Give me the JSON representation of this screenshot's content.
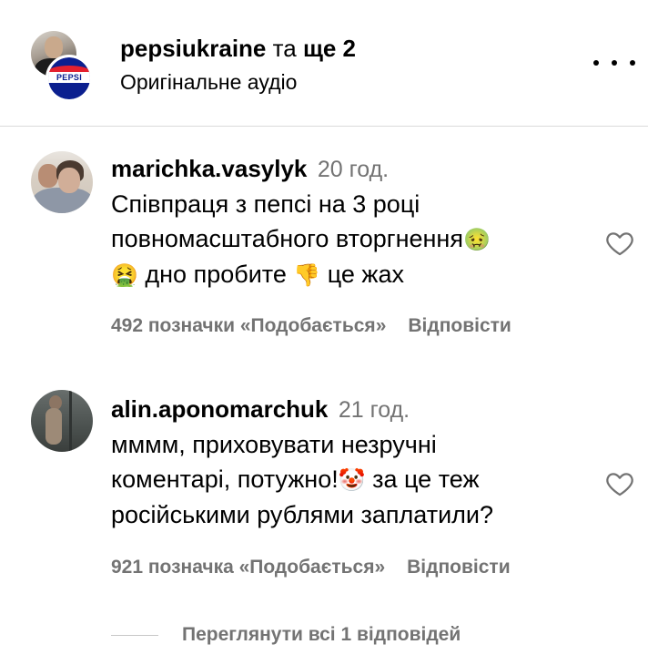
{
  "header": {
    "account": "pepsiukraine",
    "connector": " та ",
    "others": "ще 2",
    "subtitle": "Оригінальне аудіо",
    "more_icon": "more-horizontal-icon"
  },
  "comments": [
    {
      "username": "marichka.vasylyk",
      "time": "20 год.",
      "line1": "Співпраця з пепсі на 3 році",
      "line2a": "повномасштабного вторгнення",
      "emoji_nauseated": "🤢",
      "emoji_vomit": "🤮",
      "line3a": " дно пробите ",
      "emoji_thumbsdown": "👎",
      "line3b": " це жах",
      "likes": "492 позначки «Подобається»",
      "reply": "Відповісти",
      "heart_icon": "heart-outline-icon"
    },
    {
      "username": "alin.aponomarchuk",
      "time": "21 год.",
      "line1": "мммм, приховувати незручні",
      "line2a": "коментарі, потужно!",
      "emoji_clown": "🤡",
      "line2b": " за це теж",
      "line3": "російськими рублями заплатили?",
      "likes": "921 позначка «Подобається»",
      "reply": "Відповісти",
      "heart_icon": "heart-outline-icon"
    }
  ],
  "view_replies": "Переглянути всі 1 відповідей",
  "colors": {
    "secondary_text": "#737373",
    "divider": "#dbdbdb",
    "pepsi_blue": "#0b1f8f",
    "pepsi_red": "#e4202e"
  }
}
